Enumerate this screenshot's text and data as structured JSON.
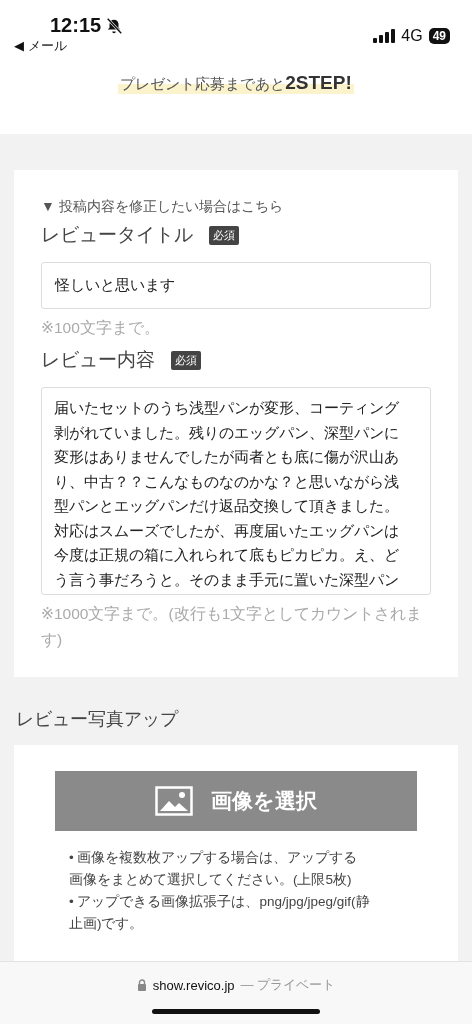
{
  "status_bar": {
    "time": "12:15",
    "back": "◀ メール",
    "network": "4G",
    "battery": "49"
  },
  "banner": {
    "text": "プレゼント応募まであと",
    "emphasis": "2STEP!"
  },
  "review_form": {
    "toggle": "▼ 投稿内容を修正したい場合はこちら",
    "fields": [
      {
        "kind": "input",
        "label": "レビュータイトル",
        "badge": "必須",
        "value": "怪しいと思います",
        "note": "※100文字まで。"
      },
      {
        "kind": "textarea",
        "label": "レビュー内容",
        "badge": "必須",
        "value": "届いたセットのうち浅型パンが変形、コーティング剥がれていました。残りのエッグパン、深型パンに変形はありませんでしたが両者とも底に傷が沢山あり、中古？？こんなものなのかな？と思いながら浅型パンとエッグパンだけ返品交換して頂きました。対応はスムーズでしたが、再度届いたエッグパンは今度は正規の箱に入れられて底もピカピカ。え、どう言う事だろうと。そのまま手元に置いた深型パン",
        "note": "※1000文字まで。(改行も1文字としてカウントされます)"
      }
    ]
  },
  "photo_section": {
    "title": "レビュー写真アップ",
    "button": "画像を選択",
    "bullets": [
      "• 画像を複数枚アップする場合は、アップする画像をまとめて選択してください。(上限5枚)",
      "• アップできる画像拡張子は、png/jpg/jpeg/gif(静止画)です。"
    ]
  },
  "browser_bar": {
    "domain": "show.revico.jp",
    "suffix": "— プライベート"
  }
}
